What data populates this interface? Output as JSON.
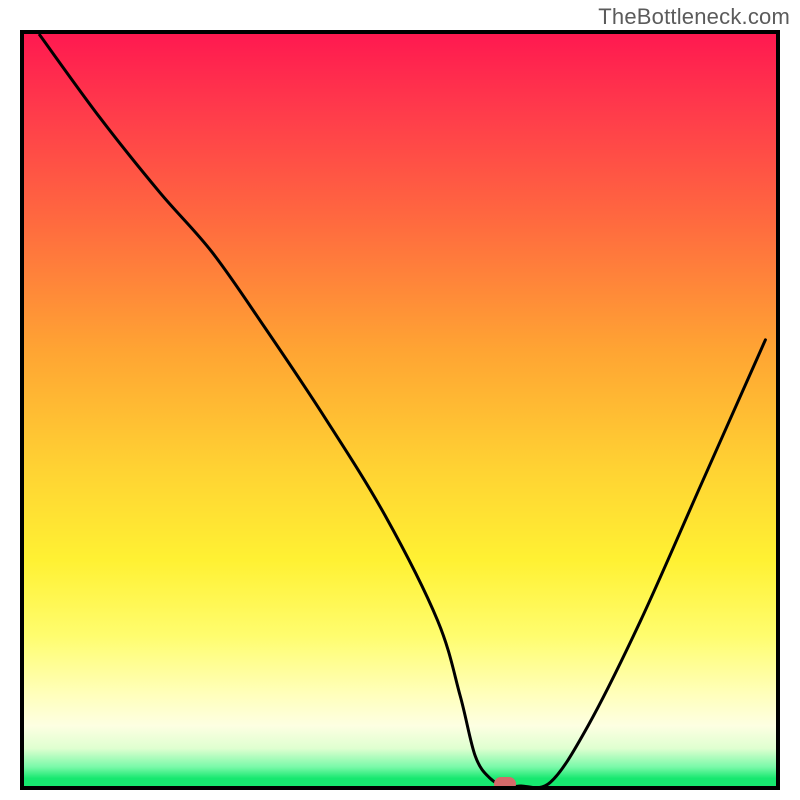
{
  "attribution": "TheBottleneck.com",
  "chart_data": {
    "type": "line",
    "title": "",
    "xlabel": "",
    "ylabel": "",
    "xlim": [
      0,
      100
    ],
    "ylim": [
      0,
      100
    ],
    "series": [
      {
        "name": "curve",
        "x": [
          2,
          10,
          18,
          25,
          32,
          40,
          48,
          55,
          58,
          60,
          62,
          64,
          66,
          70,
          75,
          82,
          90,
          98
        ],
        "y": [
          100,
          89,
          79,
          71,
          61,
          49,
          36,
          22,
          12,
          4,
          1,
          0,
          0,
          0.5,
          8,
          22,
          40,
          58
        ]
      }
    ],
    "marker": {
      "x": 64,
      "y": 0.3
    },
    "gradient_stops": [
      {
        "pos": 0.0,
        "color": "#ff1950"
      },
      {
        "pos": 0.7,
        "color": "#fff133"
      },
      {
        "pos": 0.92,
        "color": "#fdffe2"
      },
      {
        "pos": 1.0,
        "color": "#17e86f"
      }
    ]
  }
}
